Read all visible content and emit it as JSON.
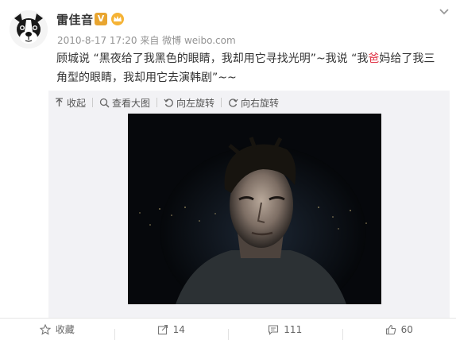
{
  "post": {
    "username": "雷佳音",
    "verified_badge": "V",
    "meta": "2010-8-17 17:20 来自 微博 weibo.com",
    "text_part1": "顾城说 “黑夜给了我黑色的眼睛，我却用它寻找光明”~我说 “我",
    "text_highlight": "爸",
    "text_part2": "妈给了我三角型的眼睛，我却用它去演韩剧”~~",
    "highlight_color": "#e0394a"
  },
  "media_toolbar": {
    "collapse_label": "收起",
    "view_large_label": "查看大图",
    "rotate_left_label": "向左旋转",
    "rotate_right_label": "向右旋转"
  },
  "actions": {
    "favorite_label": "收藏",
    "repost_count": "14",
    "comment_count": "111",
    "like_count": "60"
  },
  "icons": [
    "avatar-dog",
    "verified-v-icon",
    "crown-icon",
    "chevron-down-icon",
    "collapse-icon",
    "zoom-icon",
    "rotate-left-icon",
    "rotate-right-icon",
    "star-icon",
    "repost-icon",
    "comment-icon",
    "thumbs-up-icon"
  ]
}
